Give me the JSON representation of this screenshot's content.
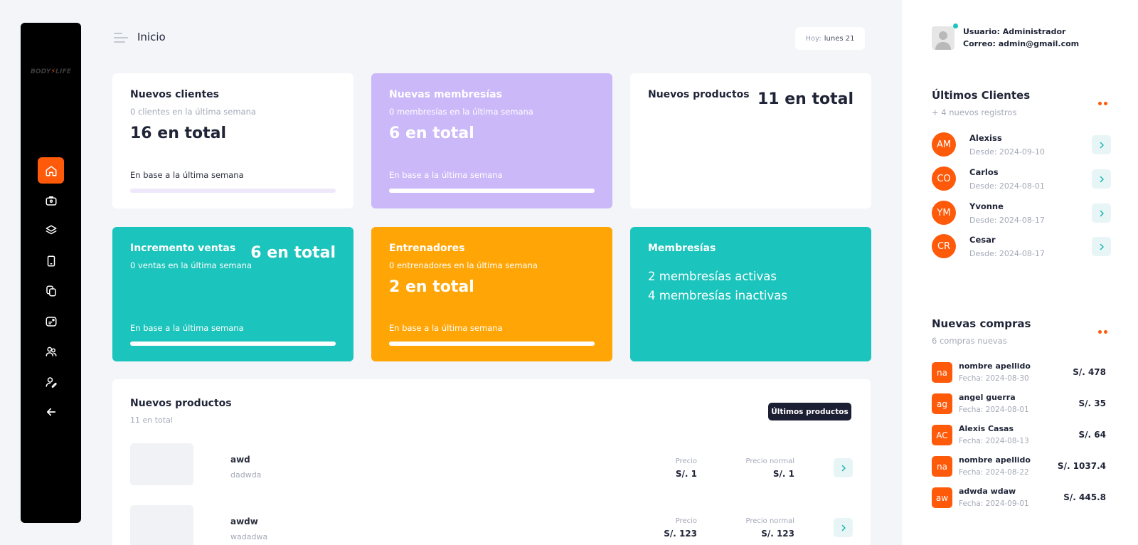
{
  "brand": {
    "text_left": "BODY",
    "text_right": "LIFE"
  },
  "sidebar": {
    "items": [
      {
        "icon": "home-icon",
        "active": true
      },
      {
        "icon": "briefcase-icon",
        "active": false
      },
      {
        "icon": "layers-icon",
        "active": false
      },
      {
        "icon": "mobile-icon",
        "active": false
      },
      {
        "icon": "copy-icon",
        "active": false
      },
      {
        "icon": "badge-icon",
        "active": false
      },
      {
        "icon": "users-icon",
        "active": false
      },
      {
        "icon": "user-edit-icon",
        "active": false
      },
      {
        "icon": "arrow-left-icon",
        "active": false
      }
    ]
  },
  "header": {
    "title": "Inicio",
    "today_label": "Hoy:",
    "today_value": "lunes 21"
  },
  "cards": {
    "clientes": {
      "title": "Nuevos clientes",
      "sub": "0 clientes en la última semana",
      "total": "16 en total",
      "foot": "En base a la última semana",
      "progress": 0
    },
    "membresias": {
      "title": "Nuevas membresías",
      "sub": "0 membresías en la última semana",
      "total": "6 en total",
      "foot": "En base a la última semana",
      "progress": 1
    },
    "productos": {
      "title": "Nuevos productos",
      "total": "11 en total"
    },
    "ventas": {
      "title": "Incremento ventas",
      "sub": "0 ventas en la última semana",
      "total": "6 en total",
      "foot": "En base a la última semana",
      "progress": 1
    },
    "entrenadores": {
      "title": "Entrenadores",
      "sub": "0 entrenadores en la última semana",
      "total": "2 en total",
      "foot": "En base a la última semana",
      "progress": 1
    },
    "membresias_estado": {
      "title": "Membresías",
      "activas": "2 membresías activas",
      "inactivas": "4 membresías inactivas"
    }
  },
  "products_panel": {
    "title": "Nuevos productos",
    "sub": "11 en total",
    "button": "Últimos productos",
    "price_label": "Precio",
    "normal_label": "Precio normal",
    "rows": [
      {
        "name": "awd",
        "desc": "dadwda",
        "price": "S/. 1",
        "normal": "S/. 1"
      },
      {
        "name": "awdw",
        "desc": "wadadwa",
        "price": "S/. 123",
        "normal": "S/. 123"
      }
    ]
  },
  "user": {
    "usuario": "Usuario: Administrador",
    "correo": "Correo: admin@gmail.com"
  },
  "clients_section": {
    "title": "Últimos Clientes",
    "sub": "+ 4 nuevos registros",
    "items": [
      {
        "initials": "AM",
        "name": "Alexiss",
        "date": "Desde: 2024-09-10"
      },
      {
        "initials": "CO",
        "name": "Carlos",
        "date": "Desde: 2024-08-01"
      },
      {
        "initials": "YM",
        "name": "Yvonne",
        "date": "Desde: 2024-08-17"
      },
      {
        "initials": "CR",
        "name": "Cesar",
        "date": "Desde: 2024-08-17"
      }
    ]
  },
  "purchases_section": {
    "title": "Nuevas compras",
    "sub": "6 compras nuevas",
    "items": [
      {
        "initials": "na",
        "name": "nombre apellido",
        "date": "Fecha: 2024-08-30",
        "amount": "S/. 478"
      },
      {
        "initials": "ag",
        "name": "angel guerra",
        "date": "Fecha: 2024-08-01",
        "amount": "S/. 35"
      },
      {
        "initials": "AC",
        "name": "Alexis Casas",
        "date": "Fecha: 2024-08-13",
        "amount": "S/. 64"
      },
      {
        "initials": "na",
        "name": "nombre apellido",
        "date": "Fecha: 2024-08-22",
        "amount": "S/. 1037.4"
      },
      {
        "initials": "aw",
        "name": "adwda wdaw",
        "date": "Fecha: 2024-09-01",
        "amount": "S/. 445.8"
      }
    ]
  },
  "colors": {
    "accent": "#ff5a0a",
    "teal": "#1bc4bc",
    "purple": "#cbb8f8",
    "orange": "#ffa606",
    "dark": "#1c1f33"
  }
}
